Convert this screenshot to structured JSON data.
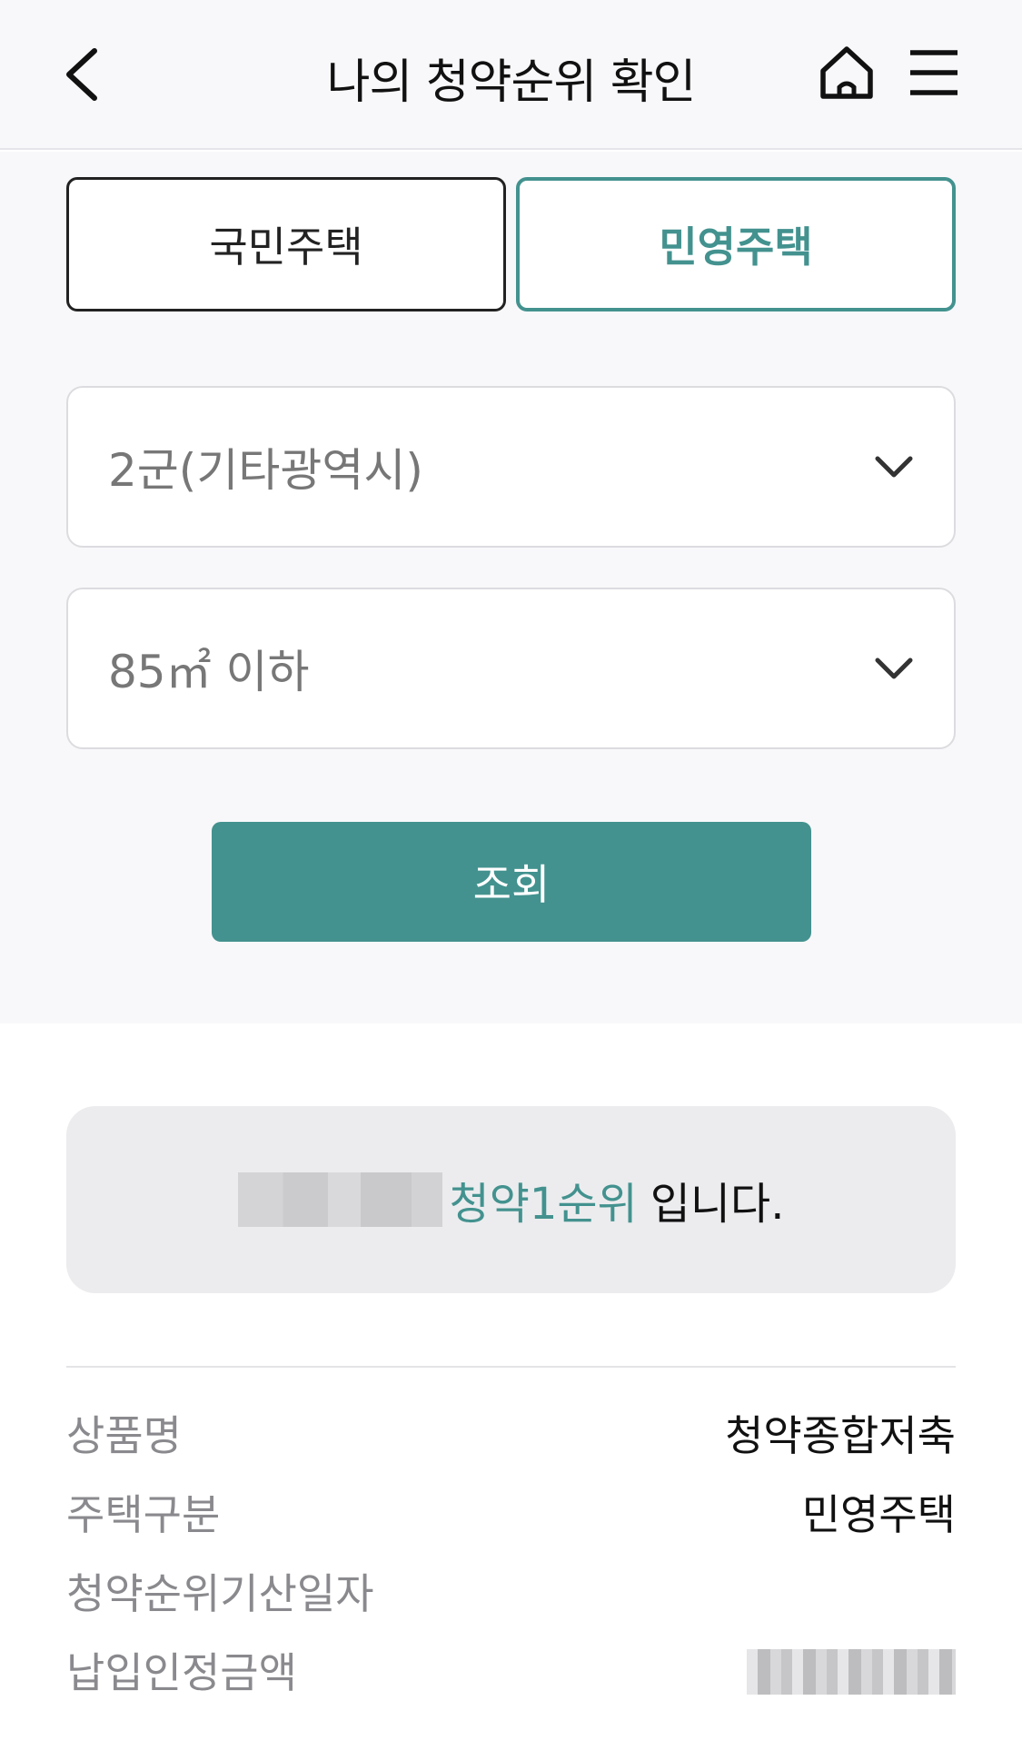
{
  "header": {
    "title": "나의 청약순위 확인"
  },
  "tabs": {
    "public_label": "국민주택",
    "private_label": "민영주택"
  },
  "filters": {
    "region": "2군(기타광역시)",
    "area": "85㎡ 이하"
  },
  "search_label": "조회",
  "result": {
    "rank_label": "청약1순위",
    "suffix": "입니다."
  },
  "info": [
    {
      "label": "상품명",
      "value": "청약종합저축"
    },
    {
      "label": "주택구분",
      "value": "민영주택"
    },
    {
      "label": "청약순위기산일자",
      "value": ""
    },
    {
      "label": "납입인정금액",
      "value": ""
    }
  ],
  "colors": {
    "accent": "#43928f",
    "background": "#f8f8fa"
  }
}
